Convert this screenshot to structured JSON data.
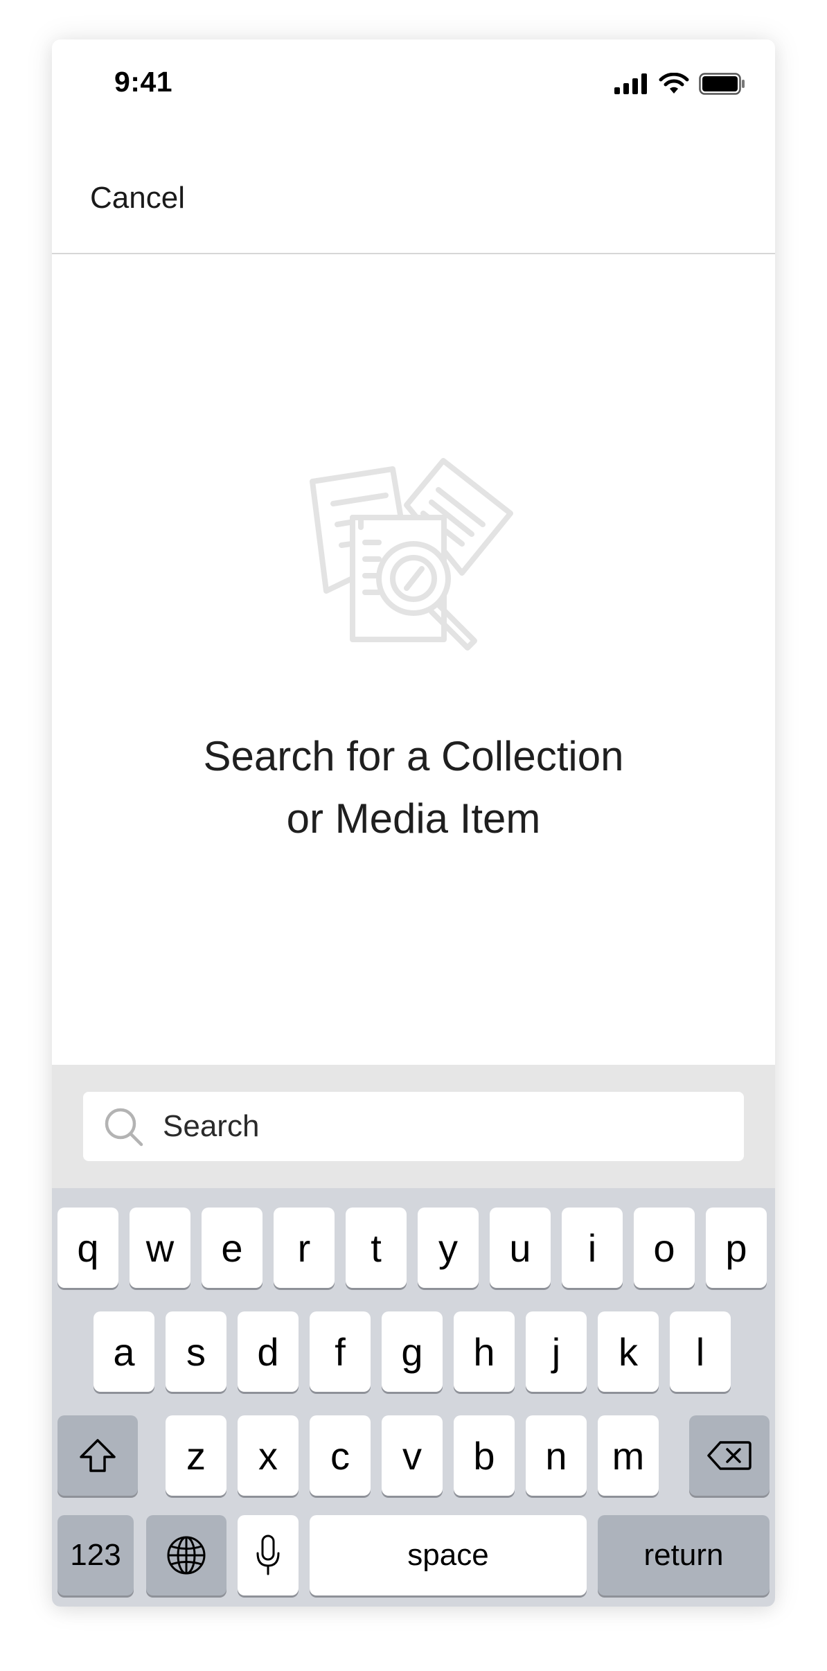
{
  "status_bar": {
    "time": "9:41",
    "icons": [
      "signal-icon",
      "wifi-icon",
      "battery-icon"
    ]
  },
  "nav": {
    "cancel_label": "Cancel"
  },
  "empty_state": {
    "icon": "document-search-icon",
    "line1": "Search for a Collection",
    "line2": "or Media Item"
  },
  "search": {
    "placeholder": "Search",
    "value": ""
  },
  "keyboard": {
    "row1": [
      "q",
      "w",
      "e",
      "r",
      "t",
      "y",
      "u",
      "i",
      "o",
      "p"
    ],
    "row2": [
      "a",
      "s",
      "d",
      "f",
      "g",
      "h",
      "j",
      "k",
      "l"
    ],
    "row3": [
      "z",
      "x",
      "c",
      "v",
      "b",
      "n",
      "m"
    ],
    "shift_icon": "shift-icon",
    "delete_icon": "backspace-icon",
    "numbers_label": "123",
    "globe_icon": "globe-icon",
    "mic_icon": "microphone-icon",
    "space_label": "space",
    "return_label": "return"
  },
  "colors": {
    "keyboard_bg": "#d3d6dc",
    "key_bg": "#ffffff",
    "special_key_bg": "#adb3bc",
    "search_area_bg": "#e6e6e6",
    "illustration_stroke": "#e6e6e6"
  }
}
